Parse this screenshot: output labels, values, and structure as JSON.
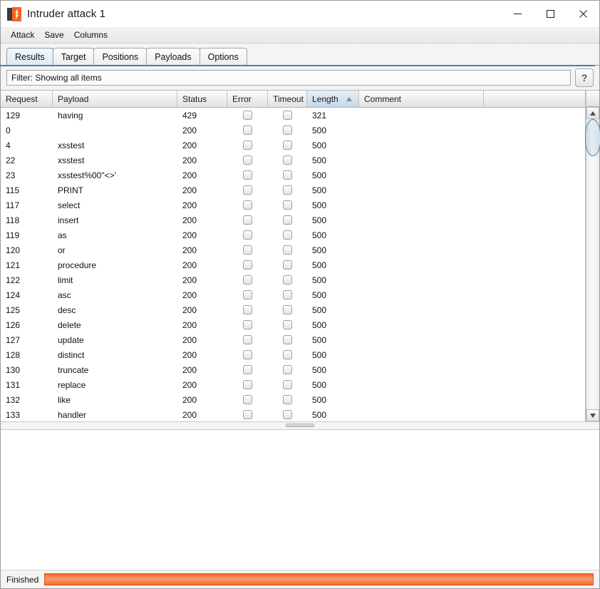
{
  "window": {
    "title": "Intruder attack 1",
    "icon": "burp-suite-icon",
    "controls": {
      "minimize": "minimize-icon",
      "maximize": "maximize-icon",
      "close": "close-icon"
    }
  },
  "menubar": {
    "items": [
      {
        "label": "Attack"
      },
      {
        "label": "Save"
      },
      {
        "label": "Columns"
      }
    ]
  },
  "tabs": [
    {
      "label": "Results",
      "selected": true
    },
    {
      "label": "Target",
      "selected": false
    },
    {
      "label": "Positions",
      "selected": false
    },
    {
      "label": "Payloads",
      "selected": false
    },
    {
      "label": "Options",
      "selected": false
    }
  ],
  "filter": {
    "label": "Filter: Showing all items",
    "help_label": "?"
  },
  "table": {
    "columns": [
      {
        "label": "Request",
        "width": 73,
        "sorted": false
      },
      {
        "label": "Payload",
        "width": 175,
        "sorted": false
      },
      {
        "label": "Status",
        "width": 70,
        "sorted": false
      },
      {
        "label": "Error",
        "width": 57,
        "sorted": false
      },
      {
        "label": "Timeout",
        "width": 55,
        "sorted": false
      },
      {
        "label": "Length",
        "width": 73,
        "sorted": true,
        "sort_direction": "ascending"
      },
      {
        "label": "Comment",
        "width": 175,
        "sorted": false
      }
    ],
    "rows": [
      {
        "request": "129",
        "payload": "having",
        "status": "429",
        "error": false,
        "timeout": false,
        "length": "321",
        "comment": ""
      },
      {
        "request": "0",
        "payload": "",
        "status": "200",
        "error": false,
        "timeout": false,
        "length": "500",
        "comment": ""
      },
      {
        "request": "4",
        "payload": "xsstest",
        "status": "200",
        "error": false,
        "timeout": false,
        "length": "500",
        "comment": ""
      },
      {
        "request": "22",
        "payload": "xsstest",
        "status": "200",
        "error": false,
        "timeout": false,
        "length": "500",
        "comment": ""
      },
      {
        "request": "23",
        "payload": "xsstest%00\"<>'",
        "status": "200",
        "error": false,
        "timeout": false,
        "length": "500",
        "comment": ""
      },
      {
        "request": "115",
        "payload": "PRINT",
        "status": "200",
        "error": false,
        "timeout": false,
        "length": "500",
        "comment": ""
      },
      {
        "request": "117",
        "payload": "select",
        "status": "200",
        "error": false,
        "timeout": false,
        "length": "500",
        "comment": ""
      },
      {
        "request": "118",
        "payload": "insert",
        "status": "200",
        "error": false,
        "timeout": false,
        "length": "500",
        "comment": ""
      },
      {
        "request": "119",
        "payload": "as",
        "status": "200",
        "error": false,
        "timeout": false,
        "length": "500",
        "comment": ""
      },
      {
        "request": "120",
        "payload": "or",
        "status": "200",
        "error": false,
        "timeout": false,
        "length": "500",
        "comment": ""
      },
      {
        "request": "121",
        "payload": "procedure",
        "status": "200",
        "error": false,
        "timeout": false,
        "length": "500",
        "comment": ""
      },
      {
        "request": "122",
        "payload": "limit",
        "status": "200",
        "error": false,
        "timeout": false,
        "length": "500",
        "comment": ""
      },
      {
        "request": "124",
        "payload": "asc",
        "status": "200",
        "error": false,
        "timeout": false,
        "length": "500",
        "comment": ""
      },
      {
        "request": "125",
        "payload": "desc",
        "status": "200",
        "error": false,
        "timeout": false,
        "length": "500",
        "comment": ""
      },
      {
        "request": "126",
        "payload": "delete",
        "status": "200",
        "error": false,
        "timeout": false,
        "length": "500",
        "comment": ""
      },
      {
        "request": "127",
        "payload": "update",
        "status": "200",
        "error": false,
        "timeout": false,
        "length": "500",
        "comment": ""
      },
      {
        "request": "128",
        "payload": "distinct",
        "status": "200",
        "error": false,
        "timeout": false,
        "length": "500",
        "comment": ""
      },
      {
        "request": "130",
        "payload": "truncate",
        "status": "200",
        "error": false,
        "timeout": false,
        "length": "500",
        "comment": ""
      },
      {
        "request": "131",
        "payload": "replace",
        "status": "200",
        "error": false,
        "timeout": false,
        "length": "500",
        "comment": ""
      },
      {
        "request": "132",
        "payload": "like",
        "status": "200",
        "error": false,
        "timeout": false,
        "length": "500",
        "comment": ""
      },
      {
        "request": "133",
        "payload": "handler",
        "status": "200",
        "error": false,
        "timeout": false,
        "length": "500",
        "comment": ""
      }
    ]
  },
  "statusbar": {
    "status": "Finished",
    "progress_percent": 100
  },
  "colors": {
    "accent_orange": "#f4682f",
    "tab_selected": "#dfeaf4",
    "sorted_header": "#c6d8e9",
    "icon_orange": "#f26522"
  }
}
